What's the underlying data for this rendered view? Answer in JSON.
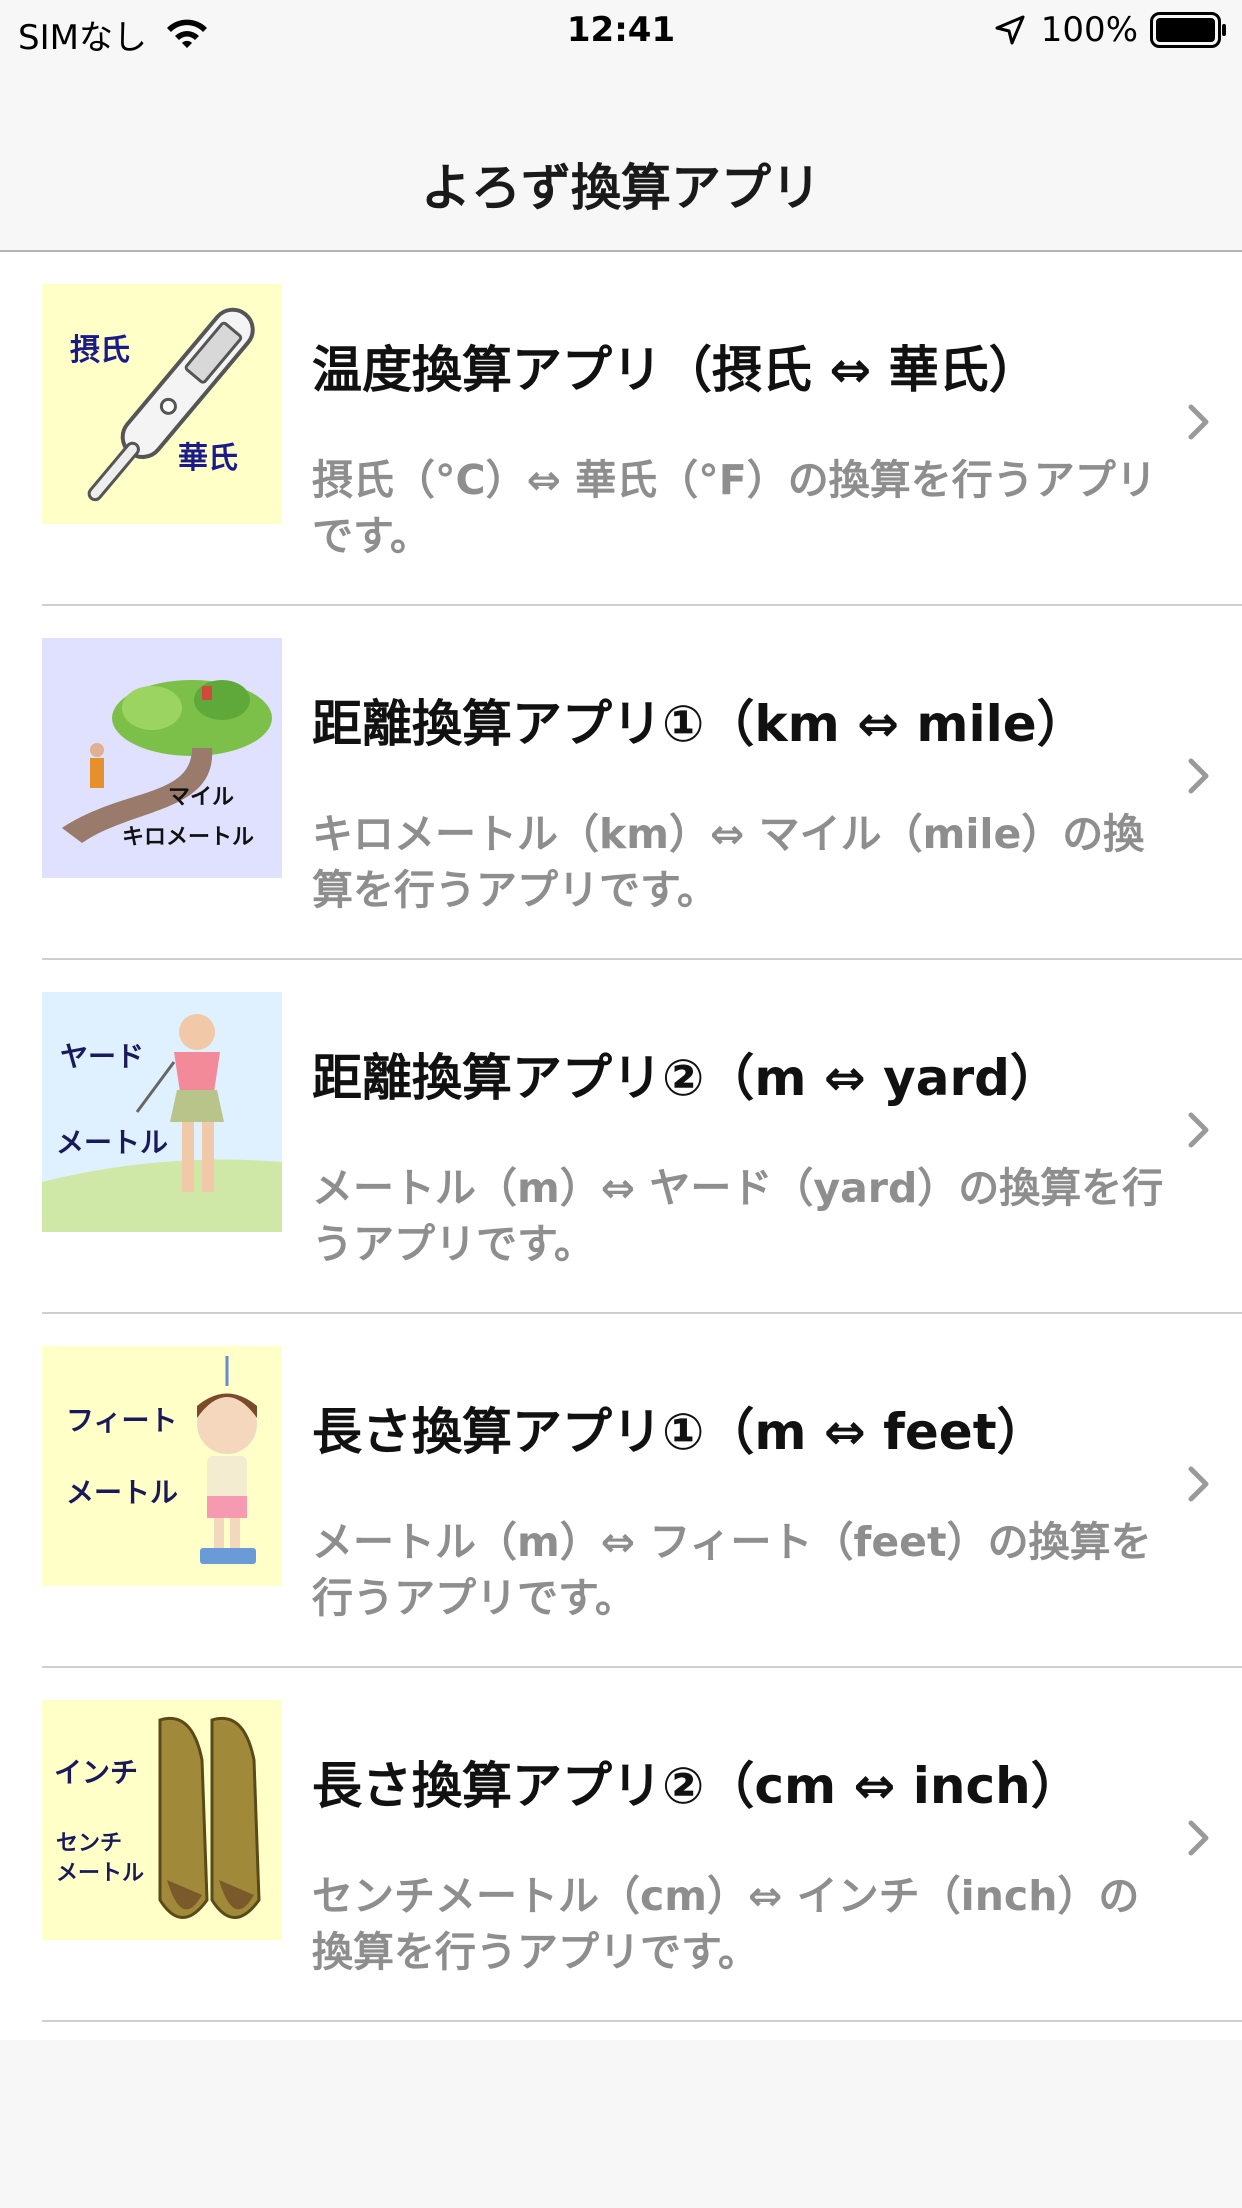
{
  "status_bar": {
    "carrier": "SIMなし",
    "time": "12:41",
    "battery": "100%"
  },
  "nav": {
    "title": "よろず換算アプリ"
  },
  "items": [
    {
      "title": "温度換算アプリ（摂氏 ⇔ 華氏）",
      "description": "摂氏（°C）⇔ 華氏（°F）の換算を行うアプリです。",
      "thumb_bg": "#ffffc8",
      "thumb_labels": [
        "摂氏",
        "華氏"
      ]
    },
    {
      "title": "距離換算アプリ①（km ⇔ mile）",
      "description": "キロメートル（km）⇔ マイル（mile）の換算を行うアプリです。",
      "thumb_bg": "#e0e0ff",
      "thumb_labels": [
        "マイル",
        "キロメートル"
      ]
    },
    {
      "title": "距離換算アプリ②（m ⇔ yard）",
      "description": "メートル（m）⇔ ヤード（yard）の換算を行うアプリです。",
      "thumb_bg": "#dff0ff",
      "thumb_labels": [
        "ヤード",
        "メートル"
      ]
    },
    {
      "title": "長さ換算アプリ①（m ⇔ feet）",
      "description": "メートル（m）⇔ フィート（feet）の換算を行うアプリです。",
      "thumb_bg": "#ffffc8",
      "thumb_labels": [
        "フィート",
        "メートル"
      ]
    },
    {
      "title": "長さ換算アプリ②（cm ⇔ inch）",
      "description": "センチメートル（cm）⇔ インチ（inch）の換算を行うアプリです。",
      "thumb_bg": "#ffffc8",
      "thumb_labels": [
        "インチ",
        "センチ",
        "メートル"
      ]
    }
  ]
}
